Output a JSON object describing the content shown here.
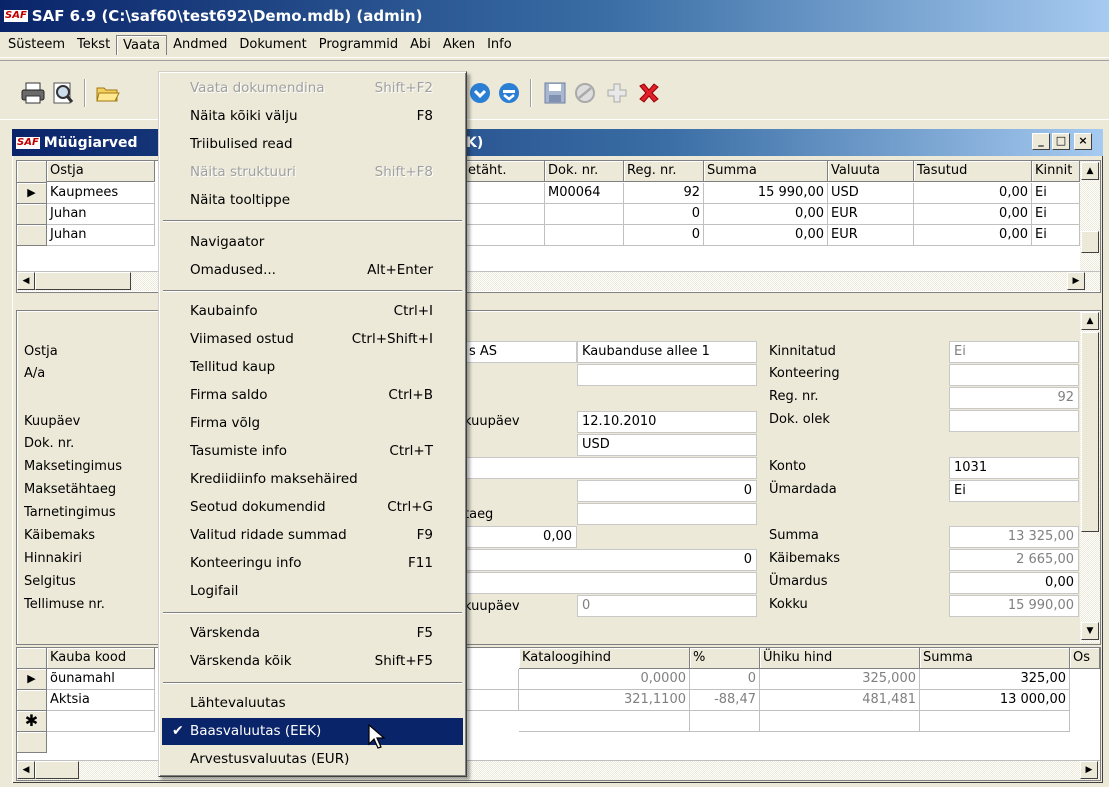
{
  "app": {
    "title": "SAF 6.9 (C:\\saf60\\test692\\Demo.mdb) (admin)",
    "logo": "SAF"
  },
  "menubar": [
    "Süsteem",
    "Tekst",
    "Vaata",
    "Andmed",
    "Dokument",
    "Programmid",
    "Abi",
    "Aken",
    "Info"
  ],
  "toolbar": {
    "icons": [
      "printer-icon",
      "print-preview-icon",
      "open-folder-icon",
      "refresh-icon",
      "down-icon",
      "save-icon",
      "cancel-icon",
      "add-icon",
      "delete-icon"
    ]
  },
  "child": {
    "title_left": "Müügiarved",
    "title_right": "K)",
    "btn_min": "_",
    "btn_max": "□",
    "btn_close": "×"
  },
  "top_grid": {
    "headers": [
      "Ostja",
      "etäht.",
      "Dok. nr.",
      "Reg. nr.",
      "Summa",
      "Valuuta",
      "Tasutud",
      "Kinnit"
    ],
    "rows": [
      {
        "ostja": "Kaupmees",
        "dok": "M00064",
        "reg": "92",
        "summa": "15 990,00",
        "val": "USD",
        "tasutud": "0,00",
        "kinnit": "Ei"
      },
      {
        "ostja": "Juhan",
        "dok": "",
        "reg": "0",
        "summa": "0,00",
        "val": "EUR",
        "tasutud": "0,00",
        "kinnit": "Ei"
      },
      {
        "ostja": "Juhan",
        "dok": "",
        "reg": "0",
        "summa": "0,00",
        "val": "EUR",
        "tasutud": "0,00",
        "kinnit": "Ei"
      }
    ]
  },
  "form": {
    "labels_left": [
      "Ostja",
      "A/a",
      "Kuupäev",
      "Dok. nr.",
      "Maksetingimus",
      "Maksetähtaeg",
      "Tarnetingimus",
      "Käibemaks",
      "Hinnakiri",
      "Selgitus",
      "Tellimuse nr."
    ],
    "mid_fragments": {
      "s_as": "s AS",
      "kuupaev": "kuupäev",
      "taeg": "taeg",
      "kuupaev2": "kuupäev"
    },
    "address": "Kaubanduse allee 1",
    "date": "12.10.2010",
    "currency": "USD",
    "zero_a": "0",
    "amount_a": "0,00",
    "zero_b": "0",
    "zero_c": "0",
    "right_labels": [
      "Kinnitatud",
      "Konteering",
      "Reg. nr.",
      "Dok. olek",
      "Konto",
      "Ümardada",
      "Summa",
      "Käibemaks",
      "Ümardus",
      "Kokku"
    ],
    "right_values": {
      "kinnitatud": "Ei",
      "regnr": "92",
      "konto": "1031",
      "umardada": "Ei",
      "summa": "13 325,00",
      "kaibemaks": "2 665,00",
      "umardus": "0,00",
      "kokku": "15 990,00"
    }
  },
  "bottom_grid": {
    "headers": [
      "Kauba kood",
      "Kataloogihind",
      "%",
      "Ühiku hind",
      "Summa",
      "Os"
    ],
    "rows": [
      {
        "kood": "õunamahl",
        "kat": "0,0000",
        "pct": "0",
        "uh": "325,000",
        "summa": "325,00"
      },
      {
        "kood": "Aktsia",
        "kat": "321,1100",
        "pct": "-88,47",
        "uh": "481,481",
        "summa": "13 000,00"
      }
    ],
    "new_row_marker": "✱"
  },
  "menu": {
    "items": [
      {
        "label": "Vaata dokumendina",
        "shortcut": "Shift+F2",
        "disabled": true
      },
      {
        "label": "Näita kõiki välju",
        "shortcut": "F8"
      },
      {
        "label": "Triibulised read",
        "shortcut": ""
      },
      {
        "label": "Näita struktuuri",
        "shortcut": "Shift+F8",
        "disabled": true
      },
      {
        "label": "Näita tooltippe",
        "shortcut": ""
      },
      {
        "label": "Navigaator",
        "shortcut": ""
      },
      {
        "label": "Omadused...",
        "shortcut": "Alt+Enter"
      },
      {
        "label": "Kaubainfo",
        "shortcut": "Ctrl+I"
      },
      {
        "label": "Viimased ostud",
        "shortcut": "Ctrl+Shift+I"
      },
      {
        "label": "Tellitud kaup",
        "shortcut": ""
      },
      {
        "label": "Firma saldo",
        "shortcut": "Ctrl+B"
      },
      {
        "label": "Firma võlg",
        "shortcut": ""
      },
      {
        "label": "Tasumiste info",
        "shortcut": "Ctrl+T"
      },
      {
        "label": "Krediidiinfo maksehäired",
        "shortcut": ""
      },
      {
        "label": "Seotud dokumendid",
        "shortcut": "Ctrl+G"
      },
      {
        "label": "Valitud ridade summad",
        "shortcut": "F9"
      },
      {
        "label": "Konteeringu info",
        "shortcut": "F11"
      },
      {
        "label": "Logifail",
        "shortcut": ""
      },
      {
        "label": "Värskenda",
        "shortcut": "F5"
      },
      {
        "label": "Värskenda kõik",
        "shortcut": "Shift+F5"
      },
      {
        "label": "Lähtevaluutas",
        "shortcut": ""
      },
      {
        "label": "Baasvaluutas (EEK)",
        "shortcut": "",
        "checked": true,
        "selected": true
      },
      {
        "label": "Arvestusvaluutas (EUR)",
        "shortcut": ""
      }
    ],
    "check_mark": "✔"
  }
}
